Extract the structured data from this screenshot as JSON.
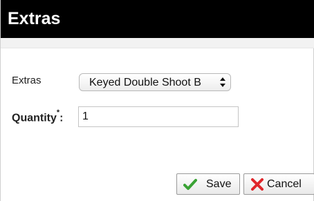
{
  "dialog": {
    "title": "Extras"
  },
  "form": {
    "extras_label": "Extras",
    "extras_selected": "Keyed Double Shoot B",
    "quantity_label": "Quantity",
    "required_marker": "*",
    "quantity_colon": ":",
    "quantity_value": "1"
  },
  "buttons": {
    "save_label": "Save",
    "cancel_label": "Cancel",
    "save_icon": "green-checkmark-icon",
    "cancel_icon": "red-x-icon"
  },
  "colors": {
    "title_bar": "#000000",
    "check_green": "#3aa335",
    "cancel_red": "#e0262b"
  }
}
